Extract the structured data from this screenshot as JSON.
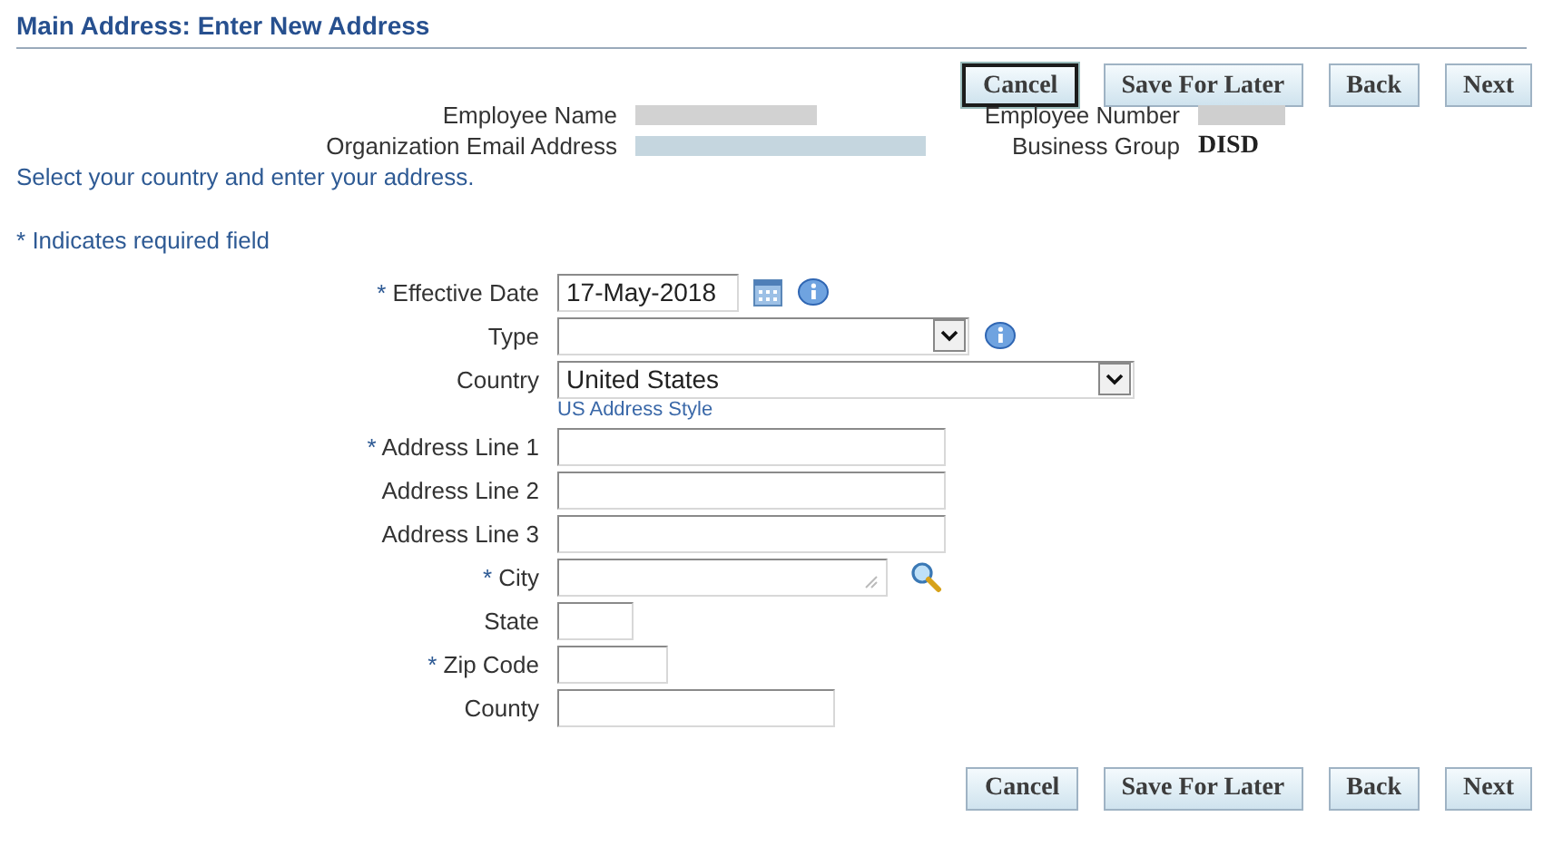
{
  "header": {
    "title": "Main Address: Enter New Address"
  },
  "top_buttons": [
    {
      "label": "Cancel",
      "focused": true
    },
    {
      "label": "Save For Later",
      "focused": false
    },
    {
      "label": "Back",
      "focused": false
    },
    {
      "label": "Next",
      "focused": false
    }
  ],
  "employee_info": {
    "left": [
      {
        "label": "Employee Name",
        "value_redacted": true,
        "kind": "short"
      },
      {
        "label": "Organization Email Address",
        "value_redacted": true,
        "kind": "long"
      }
    ],
    "right": [
      {
        "label": "Employee Number",
        "value_redacted": true
      },
      {
        "label": "Business Group",
        "value": "DISD"
      }
    ]
  },
  "instruction": "Select your country and enter your address.",
  "required_note": {
    "mark": "*",
    "text": "Indicates required field"
  },
  "fields": [
    {
      "label": "Effective Date",
      "required": true,
      "kind": "date",
      "value": "17-May-2018"
    },
    {
      "label": "Type",
      "required": false,
      "kind": "select_info"
    },
    {
      "label": "Country",
      "required": false,
      "kind": "select",
      "value": "United States",
      "link": "US Address Style"
    },
    {
      "label": "Address Line 1",
      "required": true,
      "kind": "long"
    },
    {
      "label": "Address Line 2",
      "required": false,
      "kind": "long"
    },
    {
      "label": "Address Line 3",
      "required": false,
      "kind": "long"
    },
    {
      "label": "City",
      "required": true,
      "kind": "lov"
    },
    {
      "label": "State",
      "required": false,
      "kind": "tiny"
    },
    {
      "label": "Zip Code",
      "required": true,
      "kind": "small"
    },
    {
      "label": "County",
      "required": false,
      "kind": "medium"
    }
  ],
  "bottom_buttons": [
    {
      "label": "Cancel"
    },
    {
      "label": "Save For Later"
    },
    {
      "label": "Back"
    },
    {
      "label": "Next"
    }
  ]
}
